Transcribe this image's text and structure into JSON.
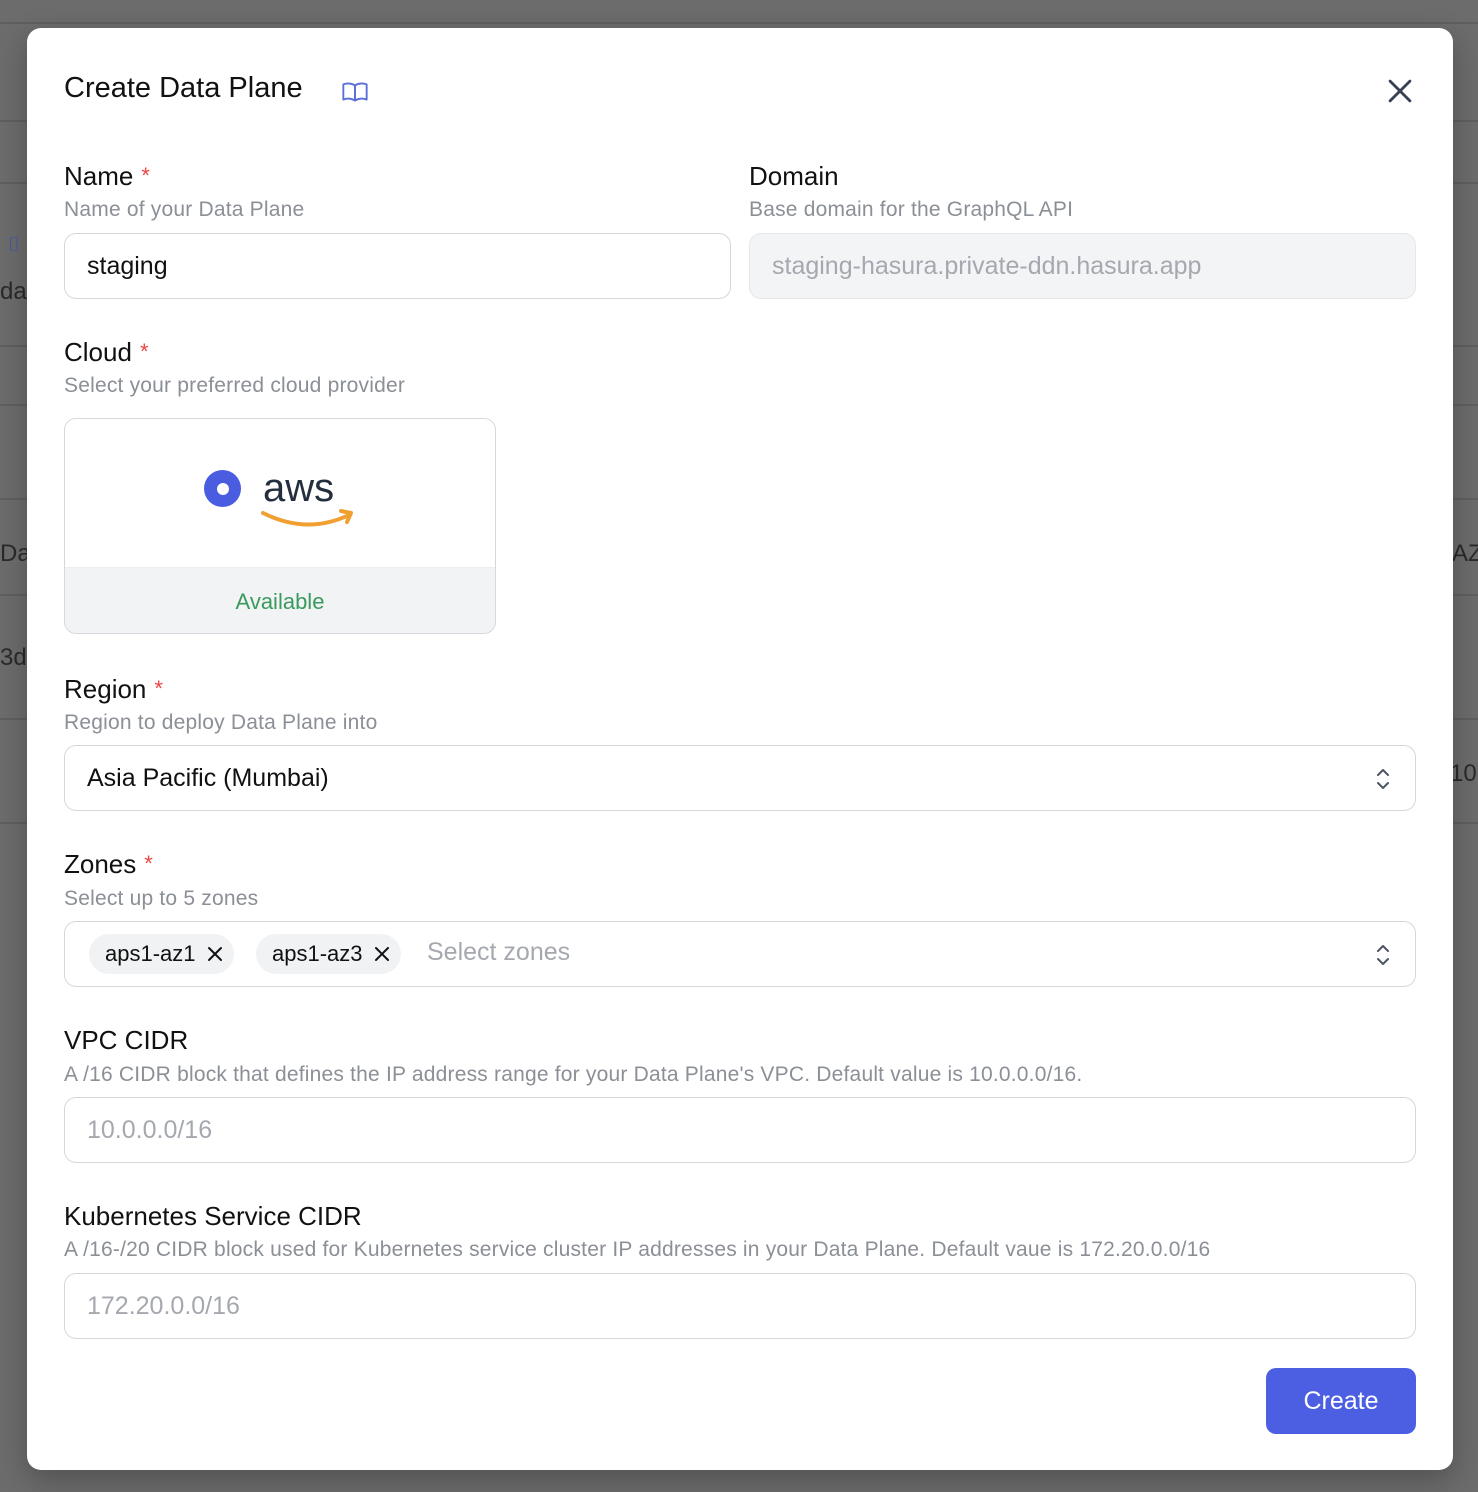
{
  "background": {
    "fragments": [
      "da",
      "Da",
      "3d",
      "AZ",
      "10"
    ]
  },
  "modal": {
    "title": "Create Data Plane",
    "docs_icon": "book-open-icon",
    "close_icon": "close-icon"
  },
  "form": {
    "name": {
      "label": "Name",
      "required_mark": "*",
      "hint": "Name of your Data Plane",
      "value": "staging"
    },
    "domain": {
      "label": "Domain",
      "hint": "Base domain for the GraphQL API",
      "placeholder": "staging-hasura.private-ddn.hasura.app"
    },
    "cloud": {
      "label": "Cloud",
      "required_mark": "*",
      "hint": "Select your preferred cloud provider",
      "option": {
        "logo_text": "aws",
        "status": "Available",
        "selected": true
      }
    },
    "region": {
      "label": "Region",
      "required_mark": "*",
      "hint": "Region to deploy Data Plane into",
      "value": "Asia Pacific (Mumbai)"
    },
    "zones": {
      "label": "Zones",
      "required_mark": "*",
      "hint": "Select up to 5 zones",
      "selected": [
        "aps1-az1",
        "aps1-az3"
      ],
      "placeholder": "Select zones"
    },
    "vpc_cidr": {
      "label": "VPC CIDR",
      "hint": "A /16 CIDR block that defines the IP address range for your Data Plane's VPC. Default value is 10.0.0.0/16.",
      "placeholder": "10.0.0.0/16"
    },
    "k8s_cidr": {
      "label": "Kubernetes Service CIDR",
      "hint": "A /16-/20 CIDR block used for Kubernetes service cluster IP addresses in your Data Plane. Default vaue is 172.20.0.0/16",
      "placeholder": "172.20.0.0/16"
    }
  },
  "actions": {
    "create_label": "Create"
  },
  "colors": {
    "accent": "#4c5fe3",
    "required": "#ef4444",
    "available": "#3a9a5e",
    "aws_smile": "#f0a030"
  }
}
